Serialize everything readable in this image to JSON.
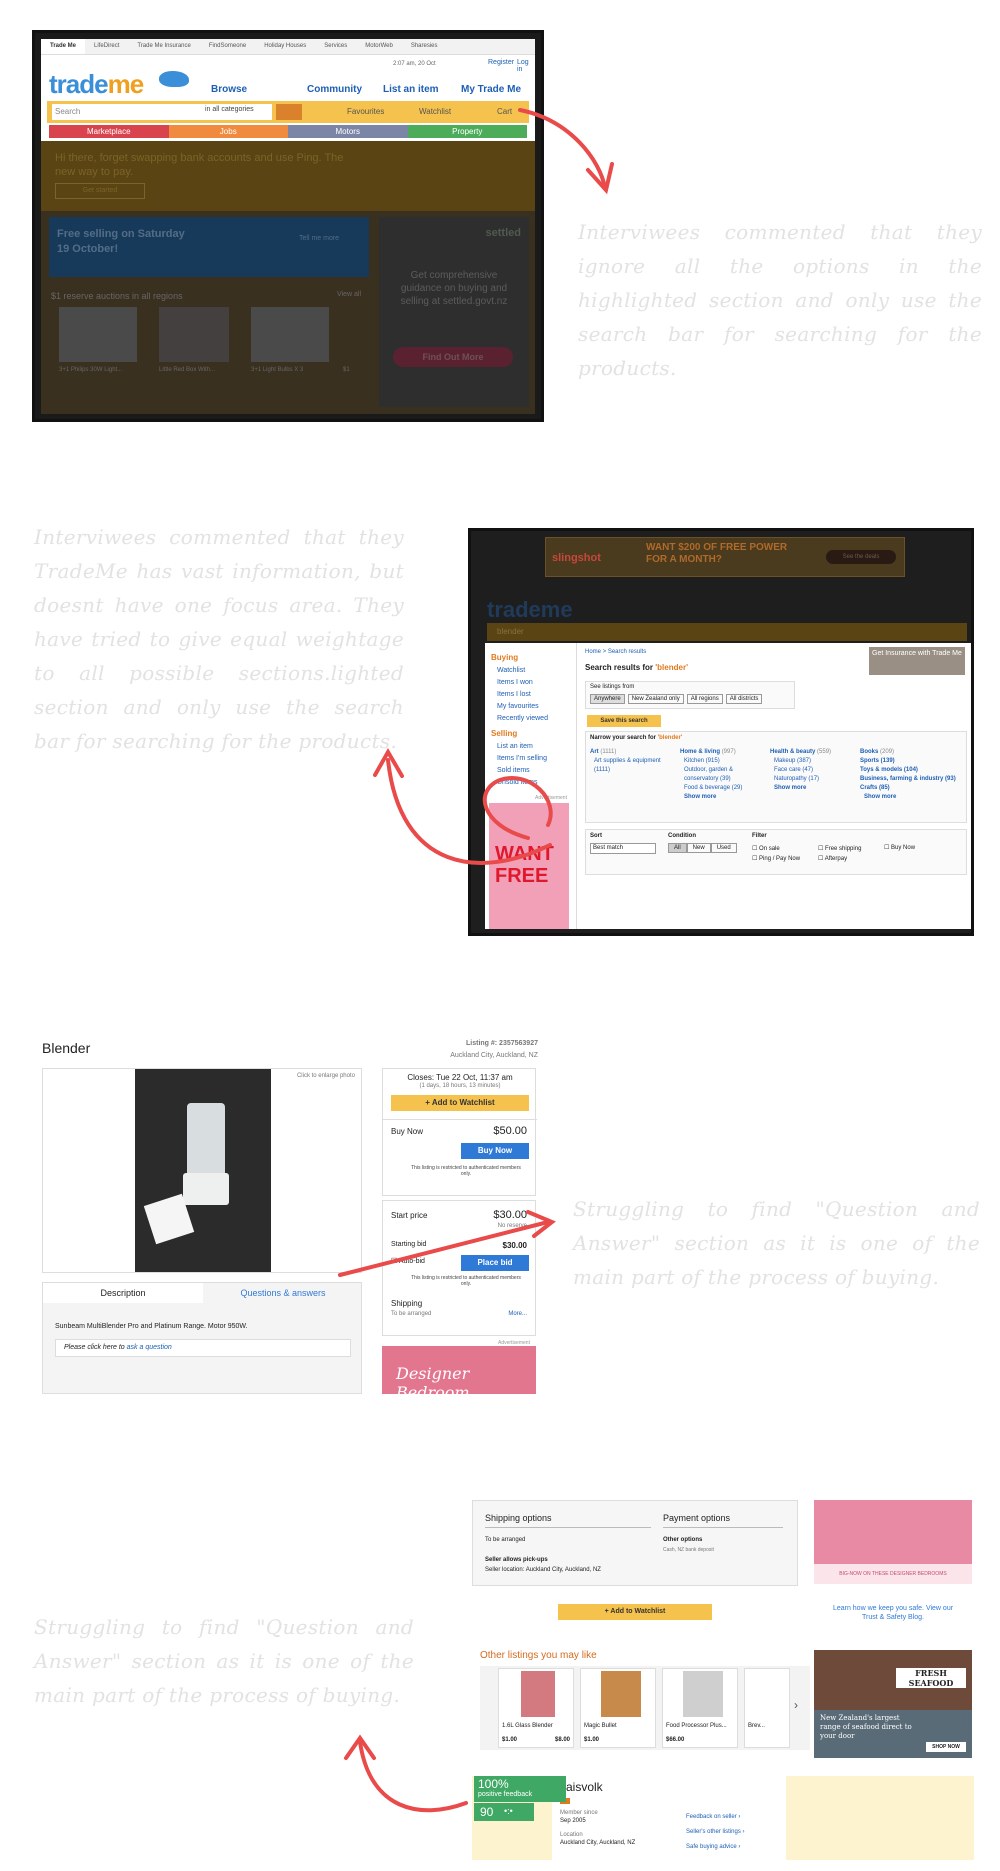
{
  "notes": {
    "n1": "Interviwees commented that they ignore all the options in the highlighted section and only use the search bar for searching for the products.",
    "n2": "Interviwees commented that they TradeMe has vast information, but doesnt have one focus area. They have tried to give equal weightage to all possible sections.lighted section and only use the search bar for searching for the products.",
    "n3": "Struggling to find \"Question and Answer\" section as it is one of the main part of the process of buying.",
    "n4": "Struggling to find \"Question and Answer\" section as it is one of the main part of the process of buying."
  },
  "shot1": {
    "tabs": [
      "Trade Me",
      "LifeDirect",
      "Trade Me Insurance",
      "FindSomeone",
      "Holiday Houses",
      "Services",
      "MotorWeb",
      "Sharesies"
    ],
    "datetime": "2:07 am, 20 Oct",
    "register": "Register",
    "login": "Log in",
    "logo_a": "trade",
    "logo_b": "me",
    "nav": [
      "Browse",
      "Community",
      "List an item",
      "My Trade Me"
    ],
    "search_placeholder": "Search",
    "category": "in all categories",
    "favourites": "Favourites",
    "watchlist": "Watchlist",
    "cart": "Cart",
    "bars": [
      {
        "label": "Marketplace",
        "color": "#d9434e"
      },
      {
        "label": "Jobs",
        "color": "#f08a3e"
      },
      {
        "label": "Motors",
        "color": "#7b86a6"
      },
      {
        "label": "Property",
        "color": "#4cac5a"
      }
    ],
    "promo": "Hi there, forget swapping bank accounts and use Ping. The new way to pay.",
    "promo_btn": "Get started",
    "banner_title": "Free selling on Saturday 19 October!",
    "banner_link": "Tell me more",
    "settled": "settled",
    "settled_sub": "govt.nz",
    "side_text": "Get comprehensive guidance on buying and selling at settled.govt.nz",
    "side_btn": "Find Out More",
    "auctions_title": "$1 reserve auctions in all regions",
    "view_all": "View all",
    "items": [
      "3+1 Philips 30W Light...",
      "Little Red Box With...",
      "3+1 Light Bulbs X 3",
      "$1"
    ]
  },
  "shot2": {
    "ad_brand": "slingshot",
    "ad_text": "WANT $200 OF FREE POWER FOR A MONTH?",
    "ad_btn": "See the deals",
    "search_value": "blender",
    "breadcrumb": "Home > Search results",
    "results_title": "Search results for",
    "query": "'blender'",
    "see_listings": "See listings from",
    "filters": [
      "Anywhere",
      "New Zealand only",
      "All regions",
      "All districts"
    ],
    "save_search": "Save this search",
    "narrow": "Narrow your search for",
    "sidebar": {
      "buying": "Buying",
      "buying_items": [
        "Watchlist",
        "Items I won",
        "Items I lost",
        "My favourites",
        "Recently viewed"
      ],
      "selling": "Selling",
      "selling_items": [
        "List an item",
        "Items I'm selling",
        "Sold items",
        "Unsold items"
      ]
    },
    "cats": [
      {
        "name": "Art",
        "count": "(1111)",
        "subs": [
          "Art supplies & equipment (1111)"
        ]
      },
      {
        "name": "Home & living",
        "count": "(997)",
        "subs": [
          "Kitchen (915)",
          "Outdoor, garden & conservatory (39)",
          "Food & beverage (29)"
        ]
      },
      {
        "name": "Health & beauty",
        "count": "(559)",
        "subs": [
          "Makeup (387)",
          "Face care (47)",
          "Naturopathy (17)"
        ]
      },
      {
        "name": "Books",
        "count": "(209)",
        "subs": [
          "Sports (139)",
          "Toys & models (104)",
          "Business, farming & industry (93)",
          "Crafts (85)"
        ]
      }
    ],
    "show_more": "Show more",
    "sort_label": "Sort",
    "sort_value": "Best match",
    "condition_label": "Condition",
    "conditions": [
      "All",
      "New",
      "Used"
    ],
    "filter_label": "Filter",
    "filter_opts": [
      "On sale",
      "Free shipping",
      "Buy Now",
      "Ping / Pay Now",
      "Afterpay"
    ],
    "insurance": "Get Insurance with Trade Me",
    "side_ad": "WANT FREE",
    "advert": "Advertisement"
  },
  "shot3": {
    "title": "Blender",
    "listing": "Listing #: 2357563927",
    "location": "Auckland City, Auckland, NZ",
    "enlarge": "Click to enlarge photo",
    "closes": "Closes: Tue 22 Oct, 11:37 am",
    "closes_sub": "(1 days, 18 hours, 13 minutes)",
    "watchlist_btn": "Add to Watchlist",
    "buy_now_label": "Buy Now",
    "buy_now_price": "$50.00",
    "buy_now_btn": "Buy Now",
    "restricted": "This listing is restricted to authenticated members only.",
    "start_label": "Start price",
    "start_price": "$30.00",
    "no_reserve": "No reserve",
    "starting_bid": "Starting bid",
    "bid_value": "$30.00",
    "autobid": "Auto-bid",
    "place_bid": "Place bid",
    "shipping": "Shipping",
    "shipping_sub": "To be arranged",
    "more": "More...",
    "tab_desc": "Description",
    "tab_qa": "Questions & answers",
    "desc": "Sunbeam MultiBlender Pro and Platinum Range. Motor 950W.",
    "ask_pre": "Please click here to",
    "ask_link": "ask a question",
    "ad_label": "Advertisement",
    "ad_text": "Designer Bedroom"
  },
  "shot4": {
    "ship_title": "Shipping options",
    "pay_title": "Payment options",
    "ship_val": "To be arranged",
    "pay_val": "Other options",
    "pay_sub": "Cash, NZ bank deposit",
    "pickup": "Seller allows pick-ups",
    "seller_loc": "Seller location: Auckland City, Auckland, NZ",
    "watch_btn": "Add to Watchlist",
    "other_title": "Other listings you may like",
    "listings": [
      {
        "name": "1.6L Glass Blender",
        "price": "$1.00",
        "buy": "$8.00"
      },
      {
        "name": "Magic Bullet",
        "price": "$1.00",
        "buy": ""
      },
      {
        "name": "Food Processor Plus...",
        "price": "$66.00",
        "buy": ""
      },
      {
        "name": "Brev...",
        "price": "",
        "buy": ""
      }
    ],
    "bedroom_link": "BIG-NOW ON THESE DESIGNER BEDROOMS",
    "safe_text": "Learn how we keep you safe. View our Trust & Safety Blog.",
    "seafood_title": "FRESH SEAFOOD",
    "seafood_text": "New Zealand's largest range of seafood direct to your door",
    "shop_now": "SHOP NOW",
    "feedback_pct": "100%",
    "feedback_label": "positive feedback",
    "feedback_count": "90",
    "seller": "zaisvolk",
    "member_since_label": "Member since",
    "member_since": "Sep 2005",
    "loc_label": "Location",
    "loc": "Auckland City, Auckland, NZ",
    "links": [
      "Feedback on seller",
      "Seller's other listings",
      "Safe buying advice"
    ]
  }
}
